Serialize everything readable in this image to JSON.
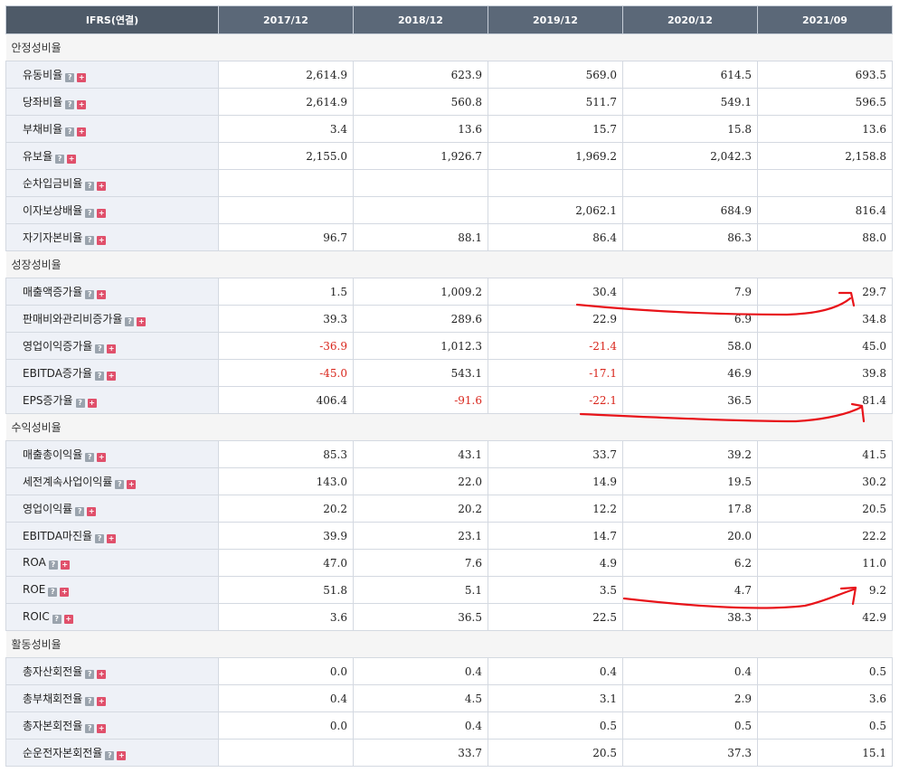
{
  "header": {
    "corner": "IFRS(연결)",
    "periods": [
      "2017/12",
      "2018/12",
      "2019/12",
      "2020/12",
      "2021/09"
    ]
  },
  "sections": [
    {
      "title": "안정성비율",
      "rows": [
        {
          "label": "유동비율",
          "values": [
            "2,614.9",
            "623.9",
            "569.0",
            "614.5",
            "693.5"
          ]
        },
        {
          "label": "당좌비율",
          "values": [
            "2,614.9",
            "560.8",
            "511.7",
            "549.1",
            "596.5"
          ]
        },
        {
          "label": "부채비율",
          "values": [
            "3.4",
            "13.6",
            "15.7",
            "15.8",
            "13.6"
          ]
        },
        {
          "label": "유보율",
          "values": [
            "2,155.0",
            "1,926.7",
            "1,969.2",
            "2,042.3",
            "2,158.8"
          ]
        },
        {
          "label": "순차입금비율",
          "values": [
            "",
            "",
            "",
            "",
            ""
          ]
        },
        {
          "label": "이자보상배율",
          "values": [
            "",
            "",
            "2,062.1",
            "684.9",
            "816.4"
          ]
        },
        {
          "label": "자기자본비율",
          "values": [
            "96.7",
            "88.1",
            "86.4",
            "86.3",
            "88.0"
          ]
        }
      ]
    },
    {
      "title": "성장성비율",
      "rows": [
        {
          "label": "매출액증가율",
          "values": [
            "1.5",
            "1,009.2",
            "30.4",
            "7.9",
            "29.7"
          ]
        },
        {
          "label": "판매비와관리비증가율",
          "values": [
            "39.3",
            "289.6",
            "22.9",
            "6.9",
            "34.8"
          ]
        },
        {
          "label": "영업이익증가율",
          "values": [
            "-36.9",
            "1,012.3",
            "-21.4",
            "58.0",
            "45.0"
          ]
        },
        {
          "label": "EBITDA증가율",
          "values": [
            "-45.0",
            "543.1",
            "-17.1",
            "46.9",
            "39.8"
          ]
        },
        {
          "label": "EPS증가율",
          "values": [
            "406.4",
            "-91.6",
            "-22.1",
            "36.5",
            "81.4"
          ]
        }
      ]
    },
    {
      "title": "수익성비율",
      "rows": [
        {
          "label": "매출총이익율",
          "values": [
            "85.3",
            "43.1",
            "33.7",
            "39.2",
            "41.5"
          ]
        },
        {
          "label": "세전계속사업이익률",
          "values": [
            "143.0",
            "22.0",
            "14.9",
            "19.5",
            "30.2"
          ]
        },
        {
          "label": "영업이익률",
          "values": [
            "20.2",
            "20.2",
            "12.2",
            "17.8",
            "20.5"
          ]
        },
        {
          "label": "EBITDA마진율",
          "values": [
            "39.9",
            "23.1",
            "14.7",
            "20.0",
            "22.2"
          ]
        },
        {
          "label": "ROA",
          "values": [
            "47.0",
            "7.6",
            "4.9",
            "6.2",
            "11.0"
          ]
        },
        {
          "label": "ROE",
          "values": [
            "51.8",
            "5.1",
            "3.5",
            "4.7",
            "9.2"
          ]
        },
        {
          "label": "ROIC",
          "values": [
            "3.6",
            "36.5",
            "22.5",
            "38.3",
            "42.9"
          ]
        }
      ]
    },
    {
      "title": "활동성비율",
      "rows": [
        {
          "label": "총자산회전율",
          "values": [
            "0.0",
            "0.4",
            "0.4",
            "0.4",
            "0.5"
          ]
        },
        {
          "label": "총부채회전율",
          "values": [
            "0.4",
            "4.5",
            "3.1",
            "2.9",
            "3.6"
          ]
        },
        {
          "label": "총자본회전율",
          "values": [
            "0.0",
            "0.4",
            "0.5",
            "0.5",
            "0.5"
          ]
        },
        {
          "label": "순운전자본회전율",
          "values": [
            "",
            "33.7",
            "20.5",
            "37.3",
            "15.1"
          ]
        }
      ]
    }
  ],
  "icons": {
    "help": "question-icon",
    "expand": "plus-icon"
  },
  "colors": {
    "header_bg": "#5b6878",
    "label_bg": "#eef1f7",
    "negative": "#d9261c",
    "annotation": "#e8141a"
  },
  "annotations": [
    {
      "type": "hand-drawn-arrow",
      "color": "#e8141a",
      "row": "매출액증가율"
    },
    {
      "type": "hand-drawn-arrow",
      "color": "#e8141a",
      "row": "EPS증가율"
    },
    {
      "type": "hand-drawn-arrow",
      "color": "#e8141a",
      "row": "ROE"
    }
  ]
}
